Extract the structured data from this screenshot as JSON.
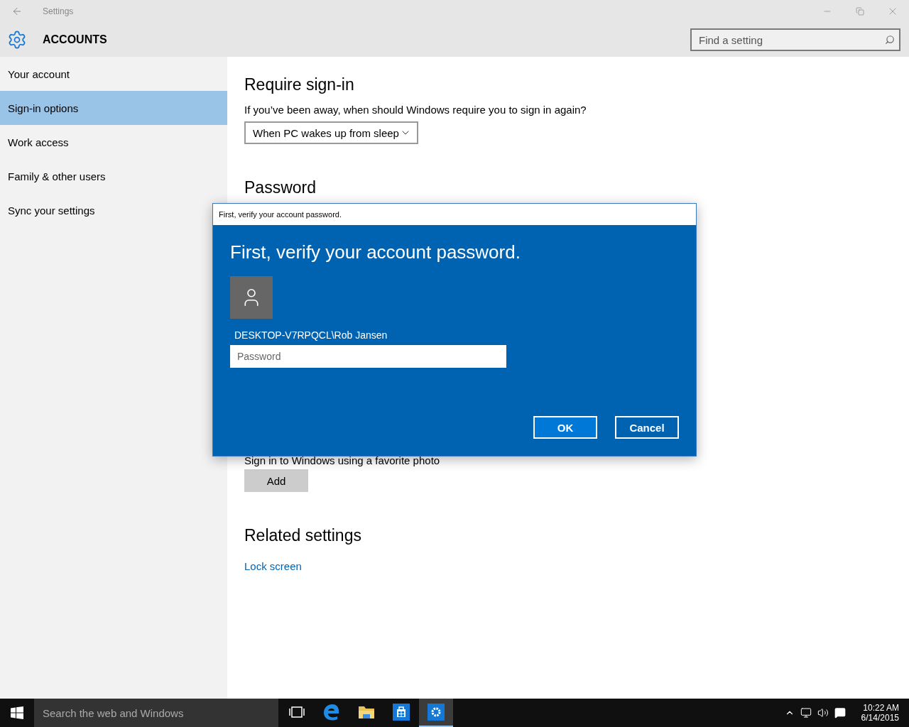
{
  "window": {
    "title": "Settings"
  },
  "header": {
    "title": "ACCOUNTS",
    "search": {
      "placeholder": "Find a setting"
    }
  },
  "sidebar": {
    "items": [
      {
        "label": "Your account",
        "selected": false
      },
      {
        "label": "Sign-in options",
        "selected": true
      },
      {
        "label": "Work access",
        "selected": false
      },
      {
        "label": "Family & other users",
        "selected": false
      },
      {
        "label": "Sync your settings",
        "selected": false
      }
    ]
  },
  "content": {
    "require_signin": {
      "heading": "Require sign-in",
      "question": "If you’ve been away, when should Windows require you to sign in again?",
      "dropdown": "When PC wakes up from sleep"
    },
    "password": {
      "heading": "Password"
    },
    "picture_password": {
      "description": "Sign in to Windows using a favorite photo",
      "button": "Add"
    },
    "related": {
      "heading": "Related settings",
      "links": [
        "Lock screen"
      ]
    }
  },
  "dialog": {
    "title": "First, verify your account password.",
    "heading": "First, verify your account password.",
    "user": "DESKTOP-V7RPQCL\\Rob Jansen",
    "password": {
      "placeholder": "Password"
    },
    "buttons": [
      {
        "label": "OK",
        "default": true
      },
      {
        "label": "Cancel",
        "default": false
      }
    ]
  },
  "taskbar": {
    "search": {
      "placeholder": "Search the web and Windows"
    },
    "apps": [
      {
        "kind": "task-view",
        "selected": false
      },
      {
        "kind": "browser",
        "selected": false
      },
      {
        "kind": "folder",
        "selected": false
      },
      {
        "kind": "store",
        "selected": false
      },
      {
        "kind": "settings",
        "selected": true
      }
    ],
    "clock": {
      "time": "10:22 AM",
      "date": "6/14/2015"
    }
  }
}
